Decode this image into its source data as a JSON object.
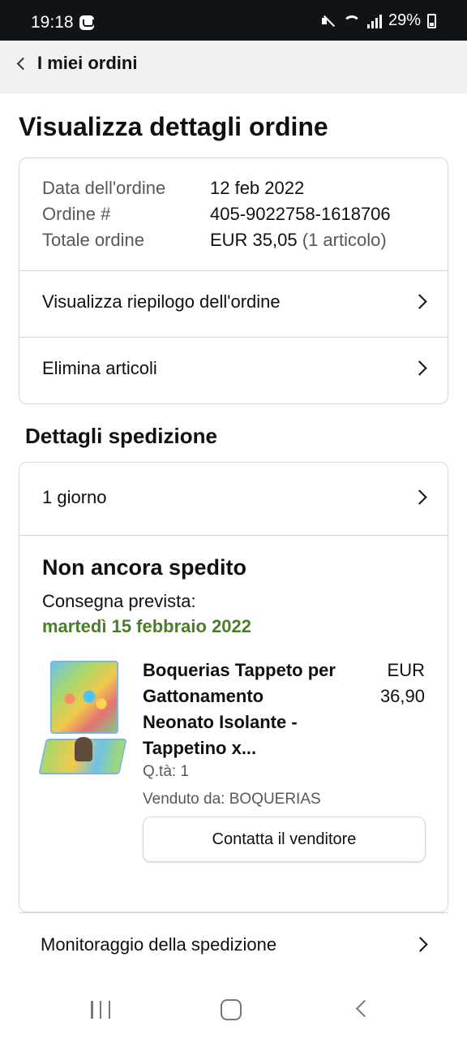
{
  "status_bar": {
    "time": "19:18",
    "battery": "29%"
  },
  "header": {
    "back_label": "I miei ordini"
  },
  "page": {
    "title": "Visualizza dettagli ordine"
  },
  "order": {
    "date_label": "Data dell'ordine",
    "date_value": "12 feb 2022",
    "number_label": "Ordine #",
    "number_value": "405-9022758-1618706",
    "total_label": "Totale ordine",
    "total_value": "EUR 35,05",
    "total_count": "(1 articolo)",
    "links": [
      {
        "label": "Visualizza riepilogo dell'ordine"
      },
      {
        "label": "Elimina articoli"
      }
    ]
  },
  "shipping": {
    "section_title": "Dettagli spedizione",
    "speed": "1 giorno",
    "status": "Non ancora spedito",
    "delivery_label": "Consegna prevista:",
    "delivery_date": "martedì 15 febbraio 2022",
    "delivery_date_color": "#4a7d29",
    "product": {
      "title": "Boquerias Tappeto per Gattonamento Neonato Isolante - Tappetino x...",
      "price_currency": "EUR",
      "price_amount": "36,90",
      "quantity": "Q.tà: 1",
      "seller": "Venduto da: BOQUERIAS"
    },
    "contact_button": "Contatta il venditore",
    "tracking_label": "Monitoraggio della spedizione"
  },
  "android_nav": {
    "icons": [
      "recent-apps-icon",
      "home-icon",
      "back-icon"
    ]
  }
}
